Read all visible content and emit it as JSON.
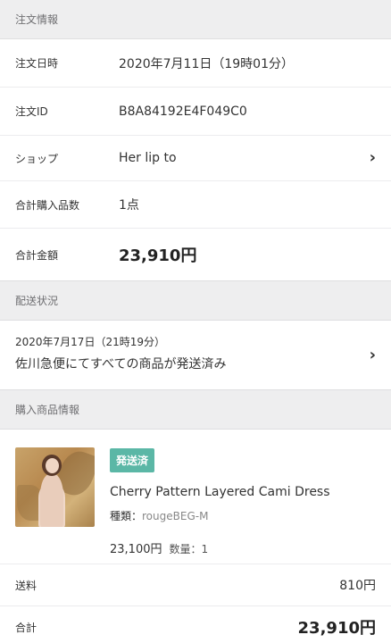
{
  "order_info": {
    "header": "注文情報",
    "date_label": "注文日時",
    "date_value": "2020年7月11日（19時01分）",
    "id_label": "注文ID",
    "id_value": "B8A84192E4F049C0",
    "shop_label": "ショップ",
    "shop_value": "Her lip to",
    "count_label": "合計購入品数",
    "count_value": "1点",
    "total_label": "合計金額",
    "total_value": "23,910円"
  },
  "shipping": {
    "header": "配送状況",
    "date": "2020年7月17日（21時19分）",
    "status": "佐川急便にてすべての商品が発送済み"
  },
  "products": {
    "header": "購入商品情報",
    "items": [
      {
        "badge": "発送済",
        "name": "Cherry Pattern Layered Cami Dress",
        "variant_label": "種類：",
        "variant_value": "rougeBEG-M",
        "price": "23,100円",
        "qty": "数量：1"
      }
    ],
    "shipping_fee_label": "送料",
    "shipping_fee_value": "810円",
    "total_label": "合計",
    "total_value": "23,910円"
  },
  "colors": {
    "badge": "#5bb7a6",
    "section_bg": "#eeeeef"
  }
}
